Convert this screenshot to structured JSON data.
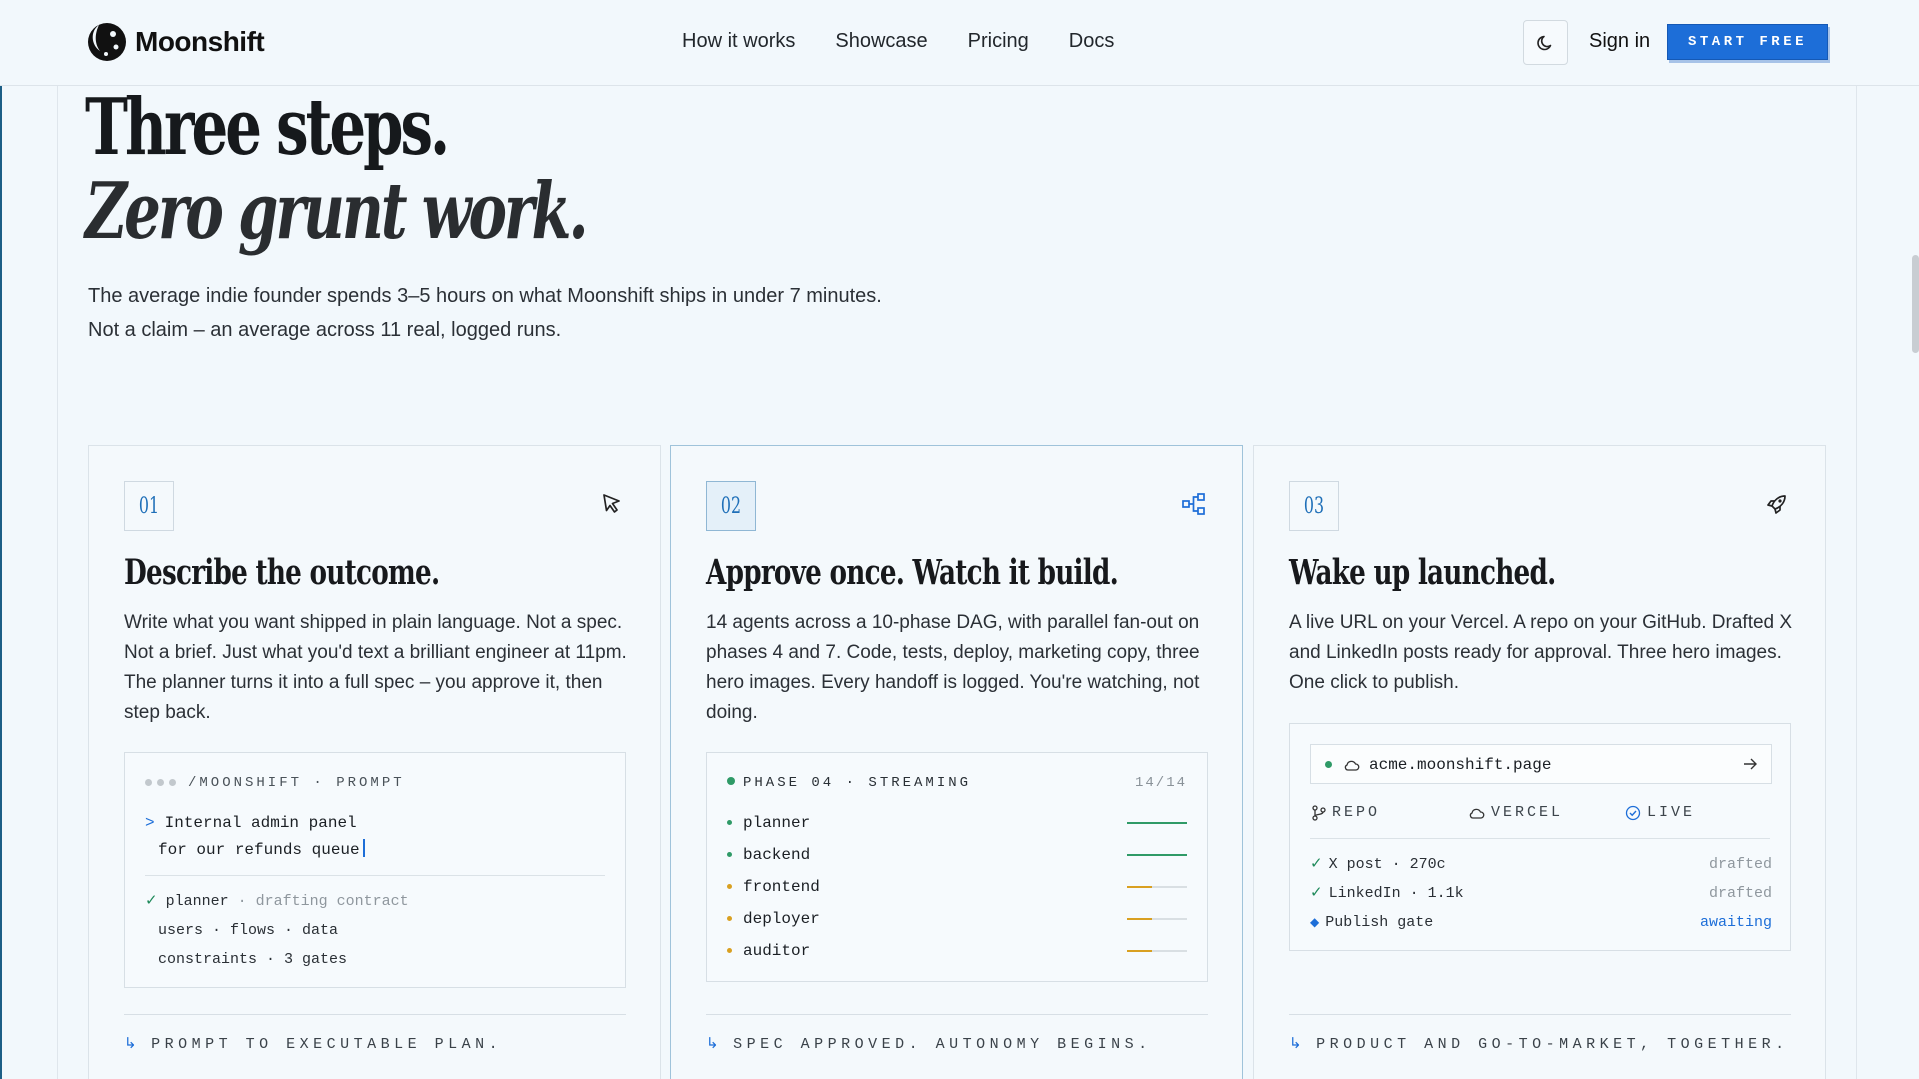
{
  "nav": {
    "brand": "Moonshift",
    "links": [
      "How it works",
      "Showcase",
      "Pricing",
      "Docs"
    ],
    "sign_in": "Sign in",
    "cta": "START FREE"
  },
  "hero": {
    "title": "Three steps.",
    "title_italic": "Zero grunt work.",
    "sub_line1": "The average indie founder spends 3–5 hours on what Moonshift ships in under 7 minutes.",
    "sub_line2": "Not a claim – an average across 11 real, logged runs."
  },
  "cards": [
    {
      "num": "01",
      "icon": "cursor-arrow-icon",
      "title": "Describe the outcome.",
      "desc": "Write what you want shipped in plain language. Not a spec. Not a brief. Just what you'd text a brilliant engineer at 11pm. The planner turns it into a full spec – you approve it, then step back.",
      "panel": {
        "head": "/MOONSHIFT · PROMPT",
        "prompt_caret": ">",
        "prompt_line1": "Internal admin panel",
        "prompt_line2": "for our refunds queue",
        "check": "✓",
        "plan_agent": "planner",
        "plan_status": "· drafting contract",
        "plan_line2": "users · flows · data",
        "plan_line3": "constraints · 3 gates"
      },
      "footer_arrow": "↳",
      "footer": "PROMPT TO EXECUTABLE PLAN."
    },
    {
      "num": "02",
      "icon": "flow-graph-icon",
      "title": "Approve once. Watch it build.",
      "desc": "14 agents across a 10-phase DAG, with parallel fan-out on phases 4 and 7. Code, tests, deploy, marketing copy, three hero images. Every handoff is logged. You're watching, not doing.",
      "panel": {
        "head": "PHASE 04 · STREAMING",
        "count": "14/14",
        "agents": [
          {
            "name": "planner",
            "progress": 1.0,
            "color": "#2f9a67"
          },
          {
            "name": "backend",
            "progress": 1.0,
            "color": "#2f9a67"
          },
          {
            "name": "frontend",
            "progress": 0.42,
            "color": "#d9a021"
          },
          {
            "name": "deployer",
            "progress": 0.42,
            "color": "#d9a021"
          },
          {
            "name": "auditor",
            "progress": 0.42,
            "color": "#d9a021"
          }
        ]
      },
      "footer_arrow": "↳",
      "footer": "SPEC APPROVED. AUTONOMY BEGINS."
    },
    {
      "num": "03",
      "icon": "rocket-icon",
      "title": "Wake up launched.",
      "desc": "A live URL on your Vercel. A repo on your GitHub. Drafted X and LinkedIn posts ready for approval. Three hero images. One click to publish.",
      "panel": {
        "url": "acme.moonshift.page",
        "repo": "REPO",
        "vercel": "VERCEL",
        "live": "LIVE",
        "check": "✓",
        "gate_mark": "◆",
        "posts": [
          {
            "label": "X post · 270c",
            "state": "drafted"
          },
          {
            "label": "LinkedIn · 1.1k",
            "state": "drafted"
          },
          {
            "label": "Publish gate",
            "state": "awaiting"
          }
        ]
      },
      "footer_arrow": "↳",
      "footer": "PRODUCT AND GO-TO-MARKET, TOGETHER."
    }
  ],
  "colors": {
    "accent": "#1d6ed8",
    "success": "#2f9a67",
    "pending": "#d9a021"
  }
}
